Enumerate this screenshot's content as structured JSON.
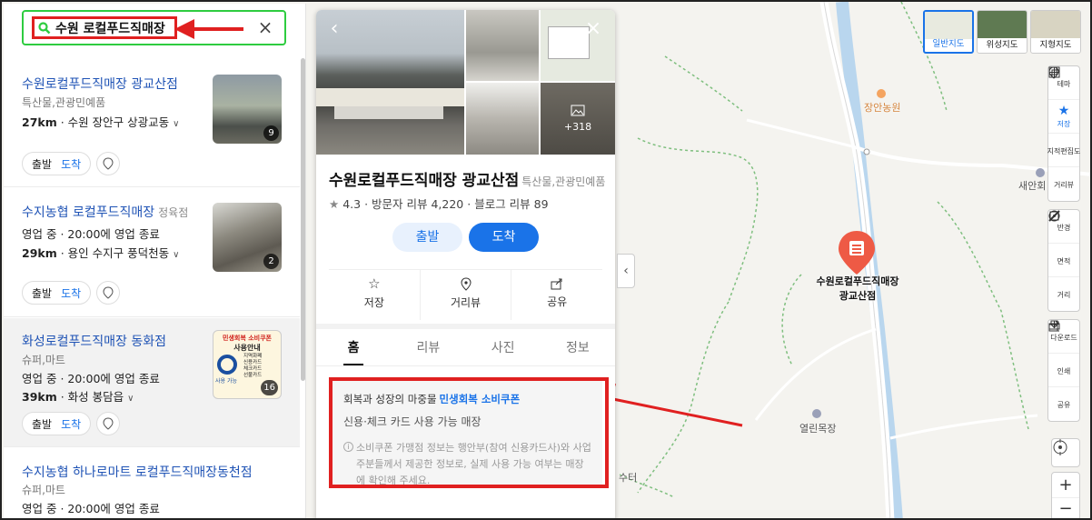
{
  "search": {
    "query": "수원 로컬푸드직매장"
  },
  "list": [
    {
      "name": "수원로컬푸드직매장 광교산점",
      "sub": "",
      "category": "특산물,관광민예품",
      "status": "",
      "dist": "27km",
      "addr": "· 수원 장안구 상광교동",
      "photo_count": "9",
      "start": "출발",
      "arrive": "도착"
    },
    {
      "name": "수지농협 로컬푸드직매장",
      "sub": "정육점",
      "category": "",
      "status": "영업 중 · 20:00에 영업 종료",
      "dist": "29km",
      "addr": "· 용인 수지구 풍덕천동",
      "photo_count": "2",
      "start": "출발",
      "arrive": "도착"
    },
    {
      "name": "화성로컬푸드직매장 동화점",
      "sub": "",
      "category": "슈퍼,마트",
      "status": "영업 중 · 20:00에 영업 종료",
      "dist": "39km",
      "addr": "· 화성 봉담읍",
      "photo_count": "16",
      "start": "출발",
      "arrive": "도착",
      "thumb_lines": [
        "민생회복 소비쿠폰",
        "사용안내",
        "지역화폐",
        "신용카드",
        "체크카드",
        "선불카드",
        "사용 가능"
      ]
    },
    {
      "name": "수지농협 하나로마트 로컬푸드직매장동천점",
      "sub": "",
      "category": "슈퍼,마트",
      "status": "영업 중 · 20:00에 영업 종료"
    }
  ],
  "detail": {
    "photo_more": "+318",
    "title": "수원로컬푸드직매장 광교산점",
    "category": "특산물,관광민예품",
    "rating": "4.3",
    "visitor_reviews": "· 방문자 리뷰 4,220",
    "blog_reviews": "· 블로그 리뷰 89",
    "start_label": "출발",
    "arrive_label": "도착",
    "actions": [
      "저장",
      "거리뷰",
      "공유"
    ],
    "tabs": [
      "홈",
      "리뷰",
      "사진",
      "정보"
    ],
    "notice": {
      "line1_prefix": "회복과 성장의 마중물",
      "line1_highlight": "민생회복 소비쿠폰",
      "line2": "신용·체크 카드 사용 가능 매장",
      "info": "소비쿠폰 가맹점 정보는 행안부(참여 신용카드사)와 사업주분들께서 제공한 정보로, 실제 사용 가능 여부는 매장에 확인해 주세요."
    }
  },
  "map": {
    "labels": {
      "jangan": "장안농원",
      "saeanhoe": "새안회",
      "yeollin": "열린목장",
      "suteo": "수터"
    },
    "poi": {
      "line1": "수원로컬푸드직매장",
      "line2": "광교산점"
    },
    "types": [
      "일반지도",
      "위성지도",
      "지형지도"
    ],
    "tools": [
      "테마",
      "저장",
      "지적편집도",
      "거리뷰",
      "반경",
      "면적",
      "거리",
      "다운로드",
      "인쇄",
      "공유"
    ]
  },
  "colors": {
    "accent": "#1a73e8",
    "highlight_red": "#e02020",
    "search_border": "#2ecc40",
    "poi_red": "#ee5a45"
  }
}
